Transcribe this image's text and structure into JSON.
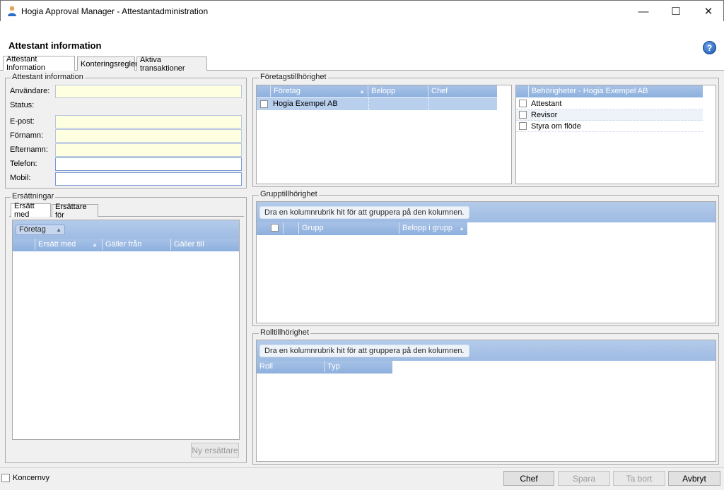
{
  "window": {
    "title": "Hogia Approval Manager - Attestantadministration",
    "minimize": "—",
    "maximize": "☐",
    "close": "✕"
  },
  "header": {
    "title": "Attestant information",
    "help": "?"
  },
  "tabs": [
    "Attestant Information",
    "Konteringsregler",
    "Aktiva transaktioner"
  ],
  "attestant": {
    "group_title": "Attestant information",
    "user_label": "Användare:",
    "status_label": "Status:",
    "email_label": "E-post:",
    "firstname_label": "Förnamn:",
    "lastname_label": "Efternamn:",
    "phone_label": "Telefon:",
    "mobile_label": "Mobil:"
  },
  "ersattningar": {
    "group_title": "Ersättningar",
    "tabs": [
      "Ersätt med",
      "Ersättare för"
    ],
    "group_chip": "Företag",
    "columns": [
      "Ersätt med",
      "Gäller från",
      "Gäller till"
    ],
    "new_button": "Ny ersättare"
  },
  "foretag": {
    "group_title": "Företagstillhörighet",
    "columns": [
      "Företag",
      "Belopp",
      "Chef"
    ],
    "rows": [
      {
        "company": "Hogia Exempel AB",
        "amount": "",
        "chef": ""
      }
    ],
    "perm_header": "Behörigheter - Hogia Exempel AB",
    "permissions": [
      "Attestant",
      "Revisor",
      "Styra om flöde"
    ]
  },
  "grupp": {
    "group_title": "Grupptillhörighet",
    "hint": "Dra en kolumnrubrik hit för att gruppera på den kolumnen.",
    "columns": [
      "Grupp",
      "Belopp i grupp"
    ]
  },
  "roll": {
    "group_title": "Rolltillhörighet",
    "hint": "Dra en kolumnrubrik hit för att gruppera på den kolumnen.",
    "columns": [
      "Roll",
      "Typ"
    ]
  },
  "footer": {
    "koncernvy": "Koncernvy",
    "buttons": [
      "Chef",
      "Spara",
      "Ta bort",
      "Avbryt"
    ]
  }
}
